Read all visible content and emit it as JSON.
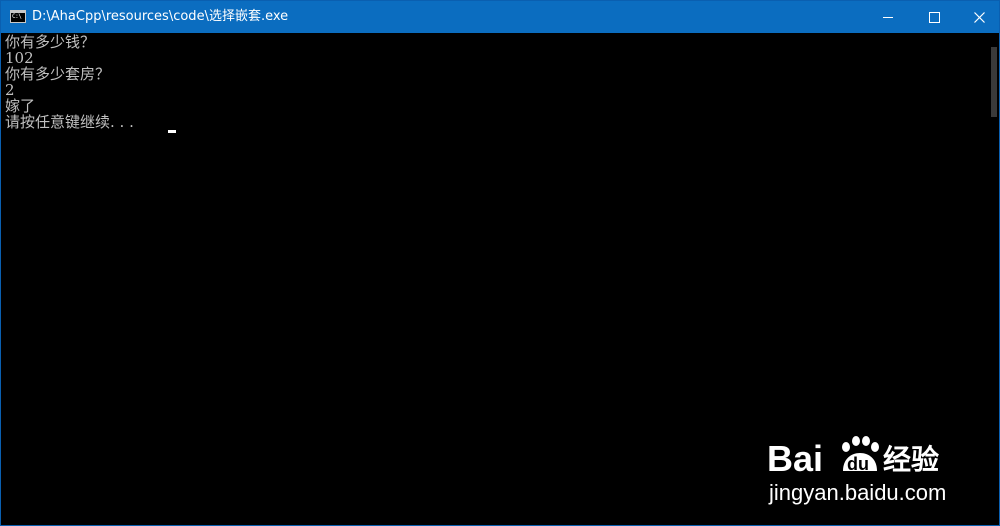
{
  "window": {
    "title": "D:\\AhaCpp\\resources\\code\\选择嵌套.exe",
    "app_icon_text": "C:\\",
    "controls": {
      "minimize_icon": "minimize-icon",
      "maximize_icon": "maximize-icon",
      "close_icon": "close-icon",
      "close_glyph": "✕"
    }
  },
  "console": {
    "lines": [
      "你有多少钱？",
      "102",
      "你有多少套房？",
      "2",
      "嫁了",
      "请按任意键继续. . ."
    ],
    "text_color": "#c0c0c0",
    "background": "#000000"
  },
  "watermark": {
    "brand_prefix": "Bai",
    "brand_suffix": "du",
    "brand_cn": "经验",
    "url": "jingyan.baidu.com"
  },
  "colors": {
    "titlebar": "#0b6dc0",
    "title_text": "#ffffff"
  }
}
